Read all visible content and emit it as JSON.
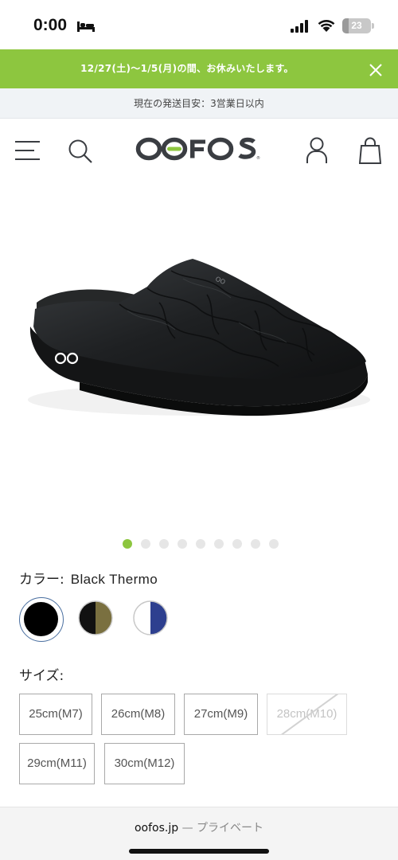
{
  "status_bar": {
    "time": "0:00",
    "battery": "23",
    "battery_level": 0.23
  },
  "announcement": {
    "text": "12/27(土)〜1/5(月)の間、お休みいたします。"
  },
  "shipping": {
    "text": "現在の発送目安：3営業日以内"
  },
  "header": {
    "logo_text": "OOFOS"
  },
  "product": {
    "image_logo": "OO",
    "carousel": {
      "count": 9,
      "active_index": 0
    },
    "color": {
      "label": "カラー:",
      "value": "Black Thermo"
    },
    "swatches": [
      {
        "name": "Black",
        "colors": [
          "#000000",
          "#000000"
        ],
        "selected": true
      },
      {
        "name": "Black/Olive",
        "colors": [
          "#111111",
          "#7a7040"
        ],
        "selected": false
      },
      {
        "name": "White/Navy",
        "colors": [
          "#ffffff",
          "#2d3f8f"
        ],
        "selected": false
      }
    ],
    "size": {
      "label": "サイズ:",
      "options": [
        {
          "label": "25cm(M7)",
          "available": true
        },
        {
          "label": "26cm(M8)",
          "available": true
        },
        {
          "label": "27cm(M9)",
          "available": true
        },
        {
          "label": "28cm(M10)",
          "available": false
        },
        {
          "label": "29cm(M11)",
          "available": true
        },
        {
          "label": "30cm(M12)",
          "available": true
        }
      ]
    }
  },
  "browser": {
    "domain": "oofos.jp",
    "separator": "—",
    "mode": "プライベート"
  },
  "colors": {
    "brand_green": "#8dc63f",
    "logo_dark": "#3a3d42",
    "shipping_bg": "#f0f3f6"
  }
}
